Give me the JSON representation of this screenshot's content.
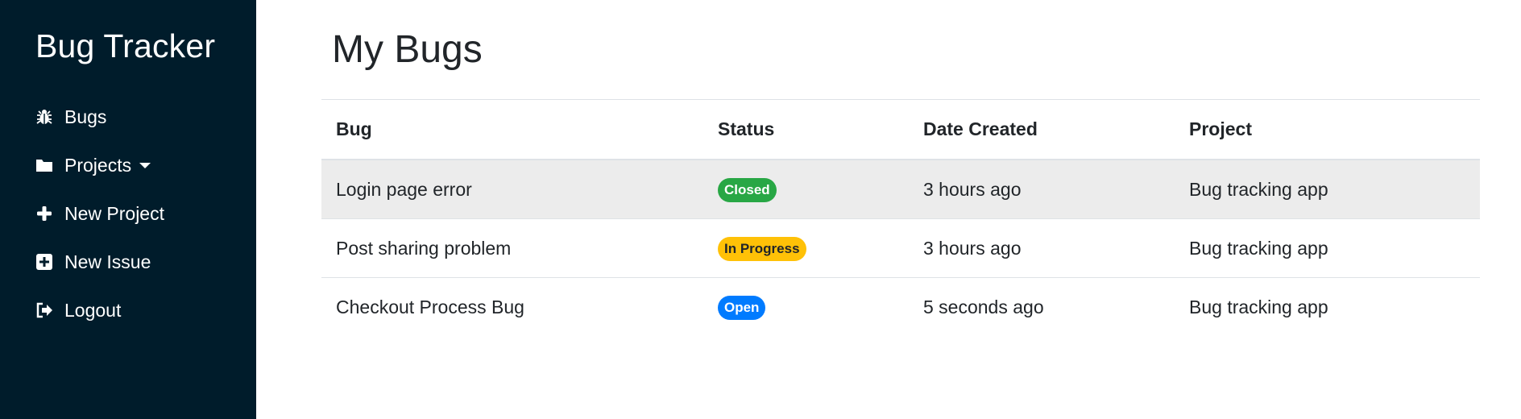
{
  "app": {
    "brand": "Bug Tracker"
  },
  "sidebar": {
    "items": [
      {
        "label": "Bugs",
        "icon": "bug-icon"
      },
      {
        "label": "Projects",
        "icon": "folder-icon",
        "dropdown": true
      },
      {
        "label": "New Project",
        "icon": "plus-icon"
      },
      {
        "label": "New Issue",
        "icon": "plus-square-icon"
      },
      {
        "label": "Logout",
        "icon": "sign-out-icon"
      }
    ]
  },
  "main": {
    "title": "My Bugs",
    "table": {
      "headers": [
        "Bug",
        "Status",
        "Date Created",
        "Project"
      ],
      "rows": [
        {
          "bug": "Login page error",
          "status": "Closed",
          "date": "3 hours ago",
          "project": "Bug tracking app"
        },
        {
          "bug": "Post sharing problem",
          "status": "In Progress",
          "date": "3 hours ago",
          "project": "Bug tracking app"
        },
        {
          "bug": "Checkout Process Bug",
          "status": "Open",
          "date": "5 seconds ago",
          "project": "Bug tracking app"
        }
      ]
    }
  },
  "colors": {
    "sidebar_bg": "#001c2b",
    "closed": "#28a745",
    "in_progress": "#ffc107",
    "open": "#007bff",
    "row_highlight": "#ececec"
  }
}
